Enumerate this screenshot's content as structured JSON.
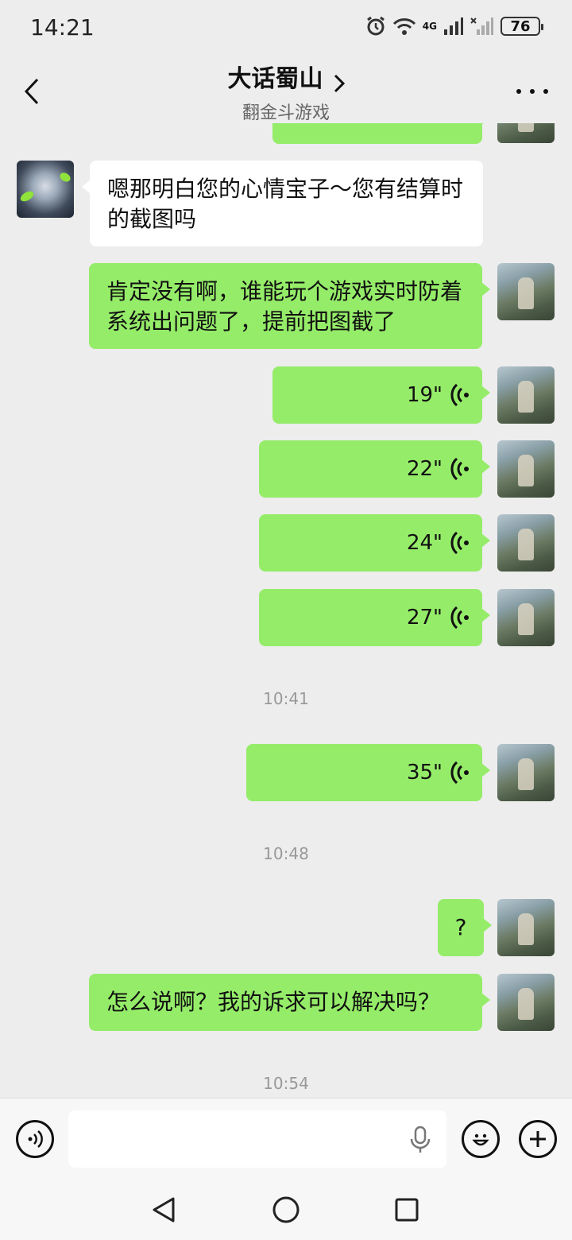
{
  "status": {
    "time": "14:21",
    "network": "4G",
    "battery": "76"
  },
  "header": {
    "title": "大话蜀山",
    "subtitle": "翻金斗游戏"
  },
  "messages": {
    "other_text": "嗯那明白您的心情宝子～您有结算时的截图吗",
    "self_text_1": "肯定没有啊，谁能玩个游戏实时防着系统出问题了，提前把图截了",
    "voice_1": "19\"",
    "voice_2": "22\"",
    "voice_3": "24\"",
    "voice_4": "27\"",
    "time_1": "10:41",
    "voice_5": "35\"",
    "time_2": "10:48",
    "self_text_2": "?",
    "self_text_3": "怎么说啊？我的诉求可以解决吗？",
    "time_3": "10:54"
  },
  "input": {
    "placeholder": ""
  },
  "icons": {
    "back": "back-arrow-icon",
    "more": "more-dots-icon",
    "voice_toggle": "voice-mode-icon",
    "mic": "microphone-icon",
    "emoji": "emoji-icon",
    "add": "add-icon",
    "voice_wave": "voice-wave-icon"
  },
  "colors": {
    "self_bubble": "#95ec69",
    "other_bubble": "#ffffff",
    "background": "#ededed"
  }
}
